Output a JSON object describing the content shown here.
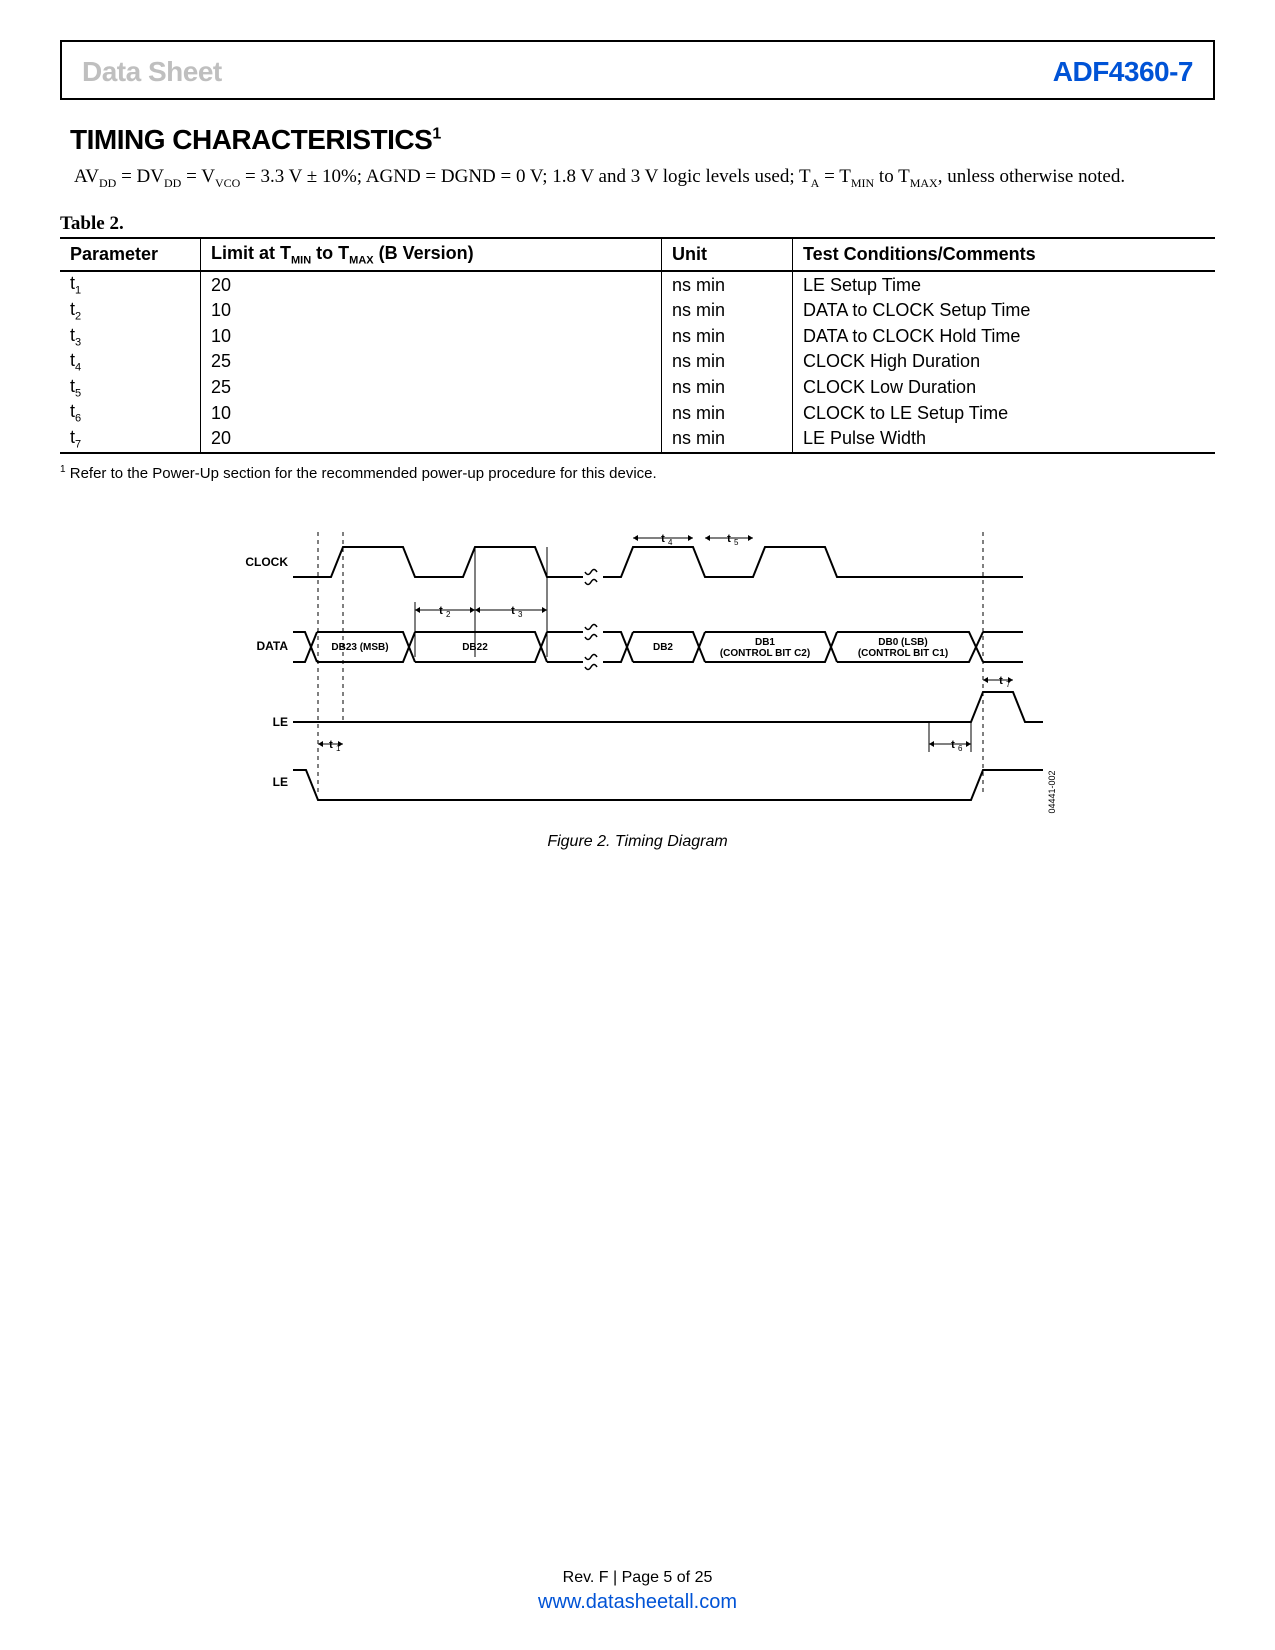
{
  "header": {
    "left": "Data Sheet",
    "right": "ADF4360-7"
  },
  "section_title": "TIMING CHARACTERISTICS",
  "section_title_sup": "1",
  "conditions_html": "AV<sub class=\"sub\">DD</sub> = DV<sub class=\"sub\">DD</sub> = V<sub class=\"sub\">VCO</sub> = 3.3 V ± 10%; AGND = DGND = 0 V; 1.8 V and 3 V logic levels used; T<sub class=\"sub\">A</sub> = T<sub class=\"sub\">MIN</sub> to T<sub class=\"sub\">MAX</sub>, unless otherwise noted.",
  "table_label": "Table 2.",
  "table": {
    "headers": {
      "param": "Parameter",
      "limit_html": "Limit at T<sub class=\"sub2\">MIN</sub> to T<sub class=\"sub2\">MAX</sub> (B Version)",
      "unit": "Unit",
      "cond": "Test Conditions/Comments"
    },
    "rows": [
      {
        "param_html": "t<sub class=\"sub2\">1</sub>",
        "limit": "20",
        "unit": "ns min",
        "cond": "LE Setup Time"
      },
      {
        "param_html": "t<sub class=\"sub2\">2</sub>",
        "limit": "10",
        "unit": "ns min",
        "cond": "DATA to CLOCK Setup Time"
      },
      {
        "param_html": "t<sub class=\"sub2\">3</sub>",
        "limit": "10",
        "unit": "ns min",
        "cond": "DATA to CLOCK Hold Time"
      },
      {
        "param_html": "t<sub class=\"sub2\">4</sub>",
        "limit": "25",
        "unit": "ns min",
        "cond": "CLOCK High Duration"
      },
      {
        "param_html": "t<sub class=\"sub2\">5</sub>",
        "limit": "25",
        "unit": "ns min",
        "cond": "CLOCK Low Duration"
      },
      {
        "param_html": "t<sub class=\"sub2\">6</sub>",
        "limit": "10",
        "unit": "ns min",
        "cond": "CLOCK to LE Setup Time"
      },
      {
        "param_html": "t<sub class=\"sub2\">7</sub>",
        "limit": "20",
        "unit": "ns min",
        "cond": "LE Pulse Width"
      }
    ]
  },
  "footnote_html": "<sup>1</sup> Refer to the Power-Up section for the recommended power-up procedure for this device.",
  "figure": {
    "caption": "Figure 2. Timing Diagram",
    "ref_number": "04441-002",
    "signals": [
      "CLOCK",
      "DATA",
      "LE",
      "LE"
    ],
    "data_bits": [
      "DB23 (MSB)",
      "DB22",
      "DB2",
      "DB1\n(CONTROL BIT C2)",
      "DB0 (LSB)\n(CONTROL BIT C1)"
    ],
    "t_labels": [
      "t1",
      "t2",
      "t3",
      "t4",
      "t5",
      "t6",
      "t7"
    ]
  },
  "footer": {
    "rev": "Rev. F | Page 5 of 25",
    "url": "www.datasheetall.com"
  }
}
